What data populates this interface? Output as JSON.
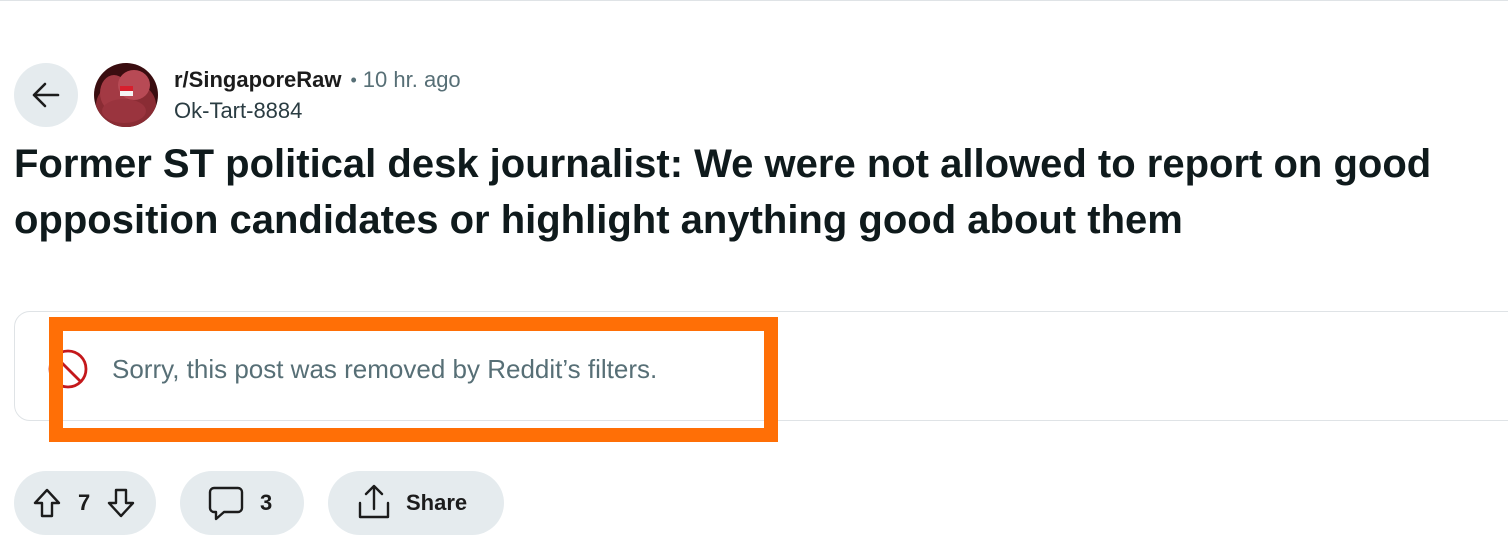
{
  "post": {
    "subreddit": "r/SingaporeRaw",
    "separator": "•",
    "time_ago": "10 hr. ago",
    "author": "Ok-Tart-8884",
    "title": "Former ST political desk journalist: We were not allowed to report on good opposition candidates or highlight anything good about them"
  },
  "removed_notice": {
    "message": "Sorry, this post was removed by Reddit’s filters.",
    "icon": "ban-icon"
  },
  "actions": {
    "upvote_icon": "upvote-arrow-icon",
    "vote_count": "7",
    "downvote_icon": "downvote-arrow-icon",
    "comment_icon": "comment-bubble-icon",
    "comment_count": "3",
    "share_icon": "share-icon",
    "share_label": "Share"
  },
  "navigation": {
    "back_icon": "back-arrow-icon"
  },
  "colors": {
    "highlight_border": "#ff6f06",
    "pill_background": "#e5ebee",
    "ban_icon_red": "#c4181b",
    "muted_text": "#576f76"
  }
}
